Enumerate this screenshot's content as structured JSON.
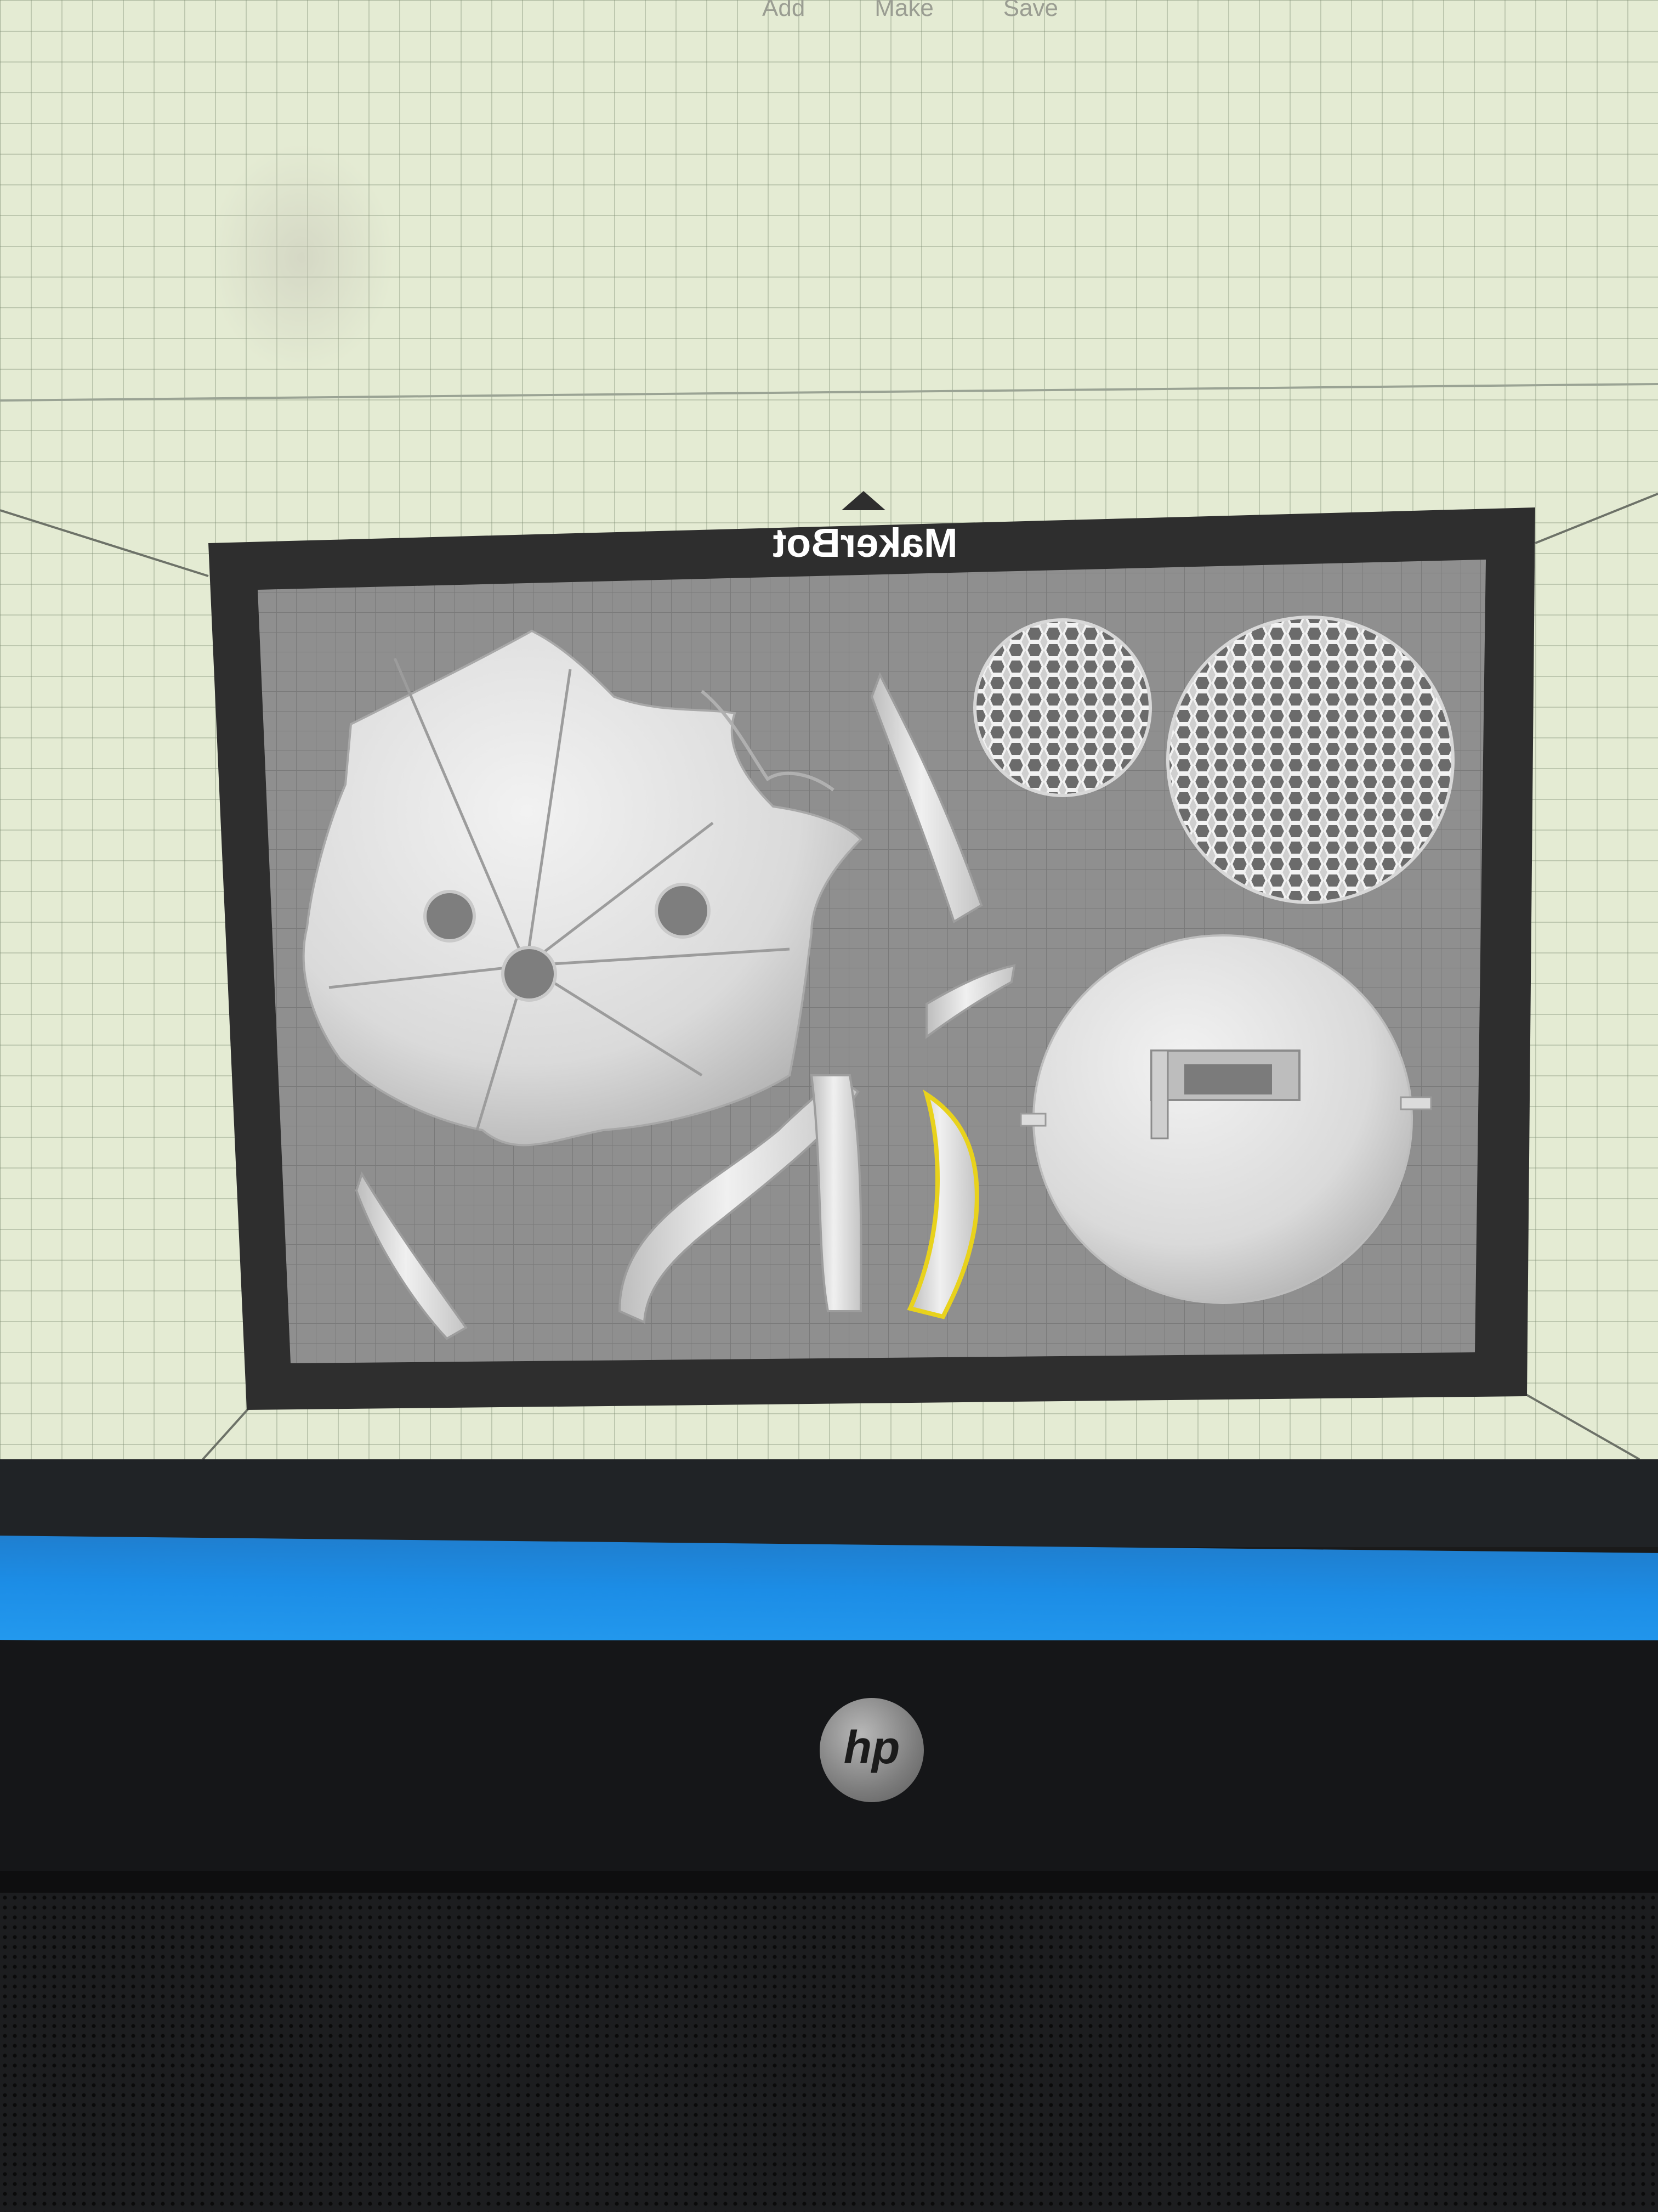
{
  "toolbar": {
    "add_label": "Add",
    "make_label": "Make",
    "save_label": "Save"
  },
  "build_plate": {
    "brand_label": "MakerBot"
  },
  "laptop": {
    "logo_text": "hp"
  },
  "colors": {
    "workspace_grid": "#e4ebd3",
    "plate_frame": "#2e2e2e",
    "plate_surface": "#8f8f8f",
    "model": "#e6e6e6",
    "selection_outline": "#e8d21c",
    "taskbar": "#1c8de6"
  }
}
